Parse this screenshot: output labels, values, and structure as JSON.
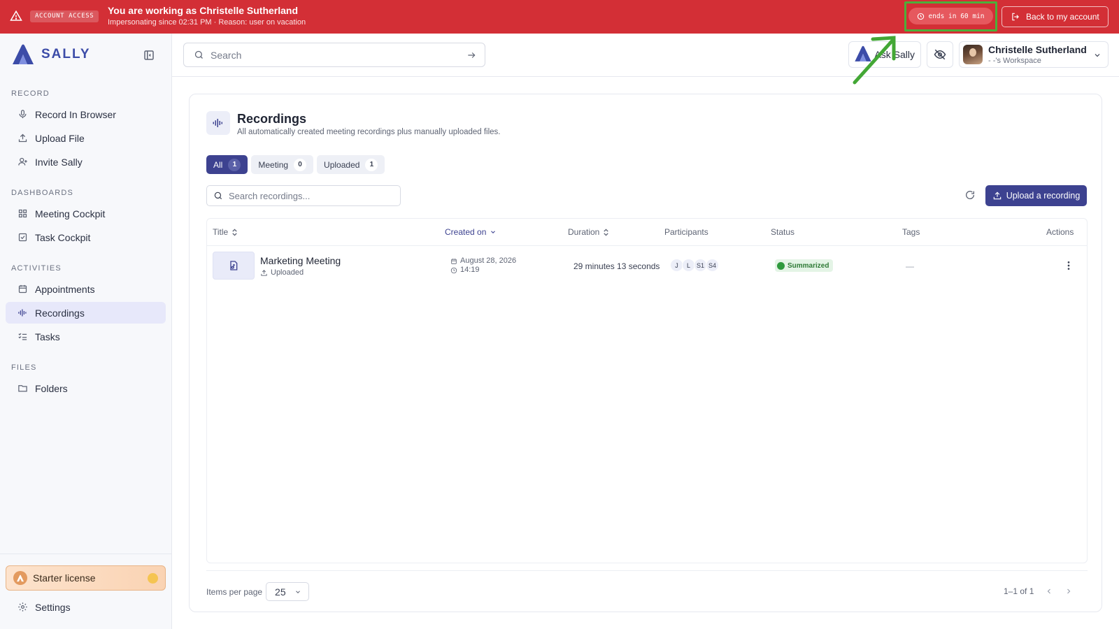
{
  "banner": {
    "tag": "ACCOUNT ACCESS",
    "title": "You are working as Christelle Sutherland",
    "subtitle": "Impersonating since 02:31 PM · Reason: user on vacation",
    "timer": "ends in 60 min",
    "back_label": "Back to my account"
  },
  "sidebar": {
    "brand": "SALLY",
    "sections": {
      "record": "RECORD",
      "dashboards": "DASHBOARDS",
      "activities": "ACTIVITIES",
      "files": "FILES"
    },
    "items": {
      "record_browser": "Record In Browser",
      "upload_file": "Upload File",
      "invite_sally": "Invite Sally",
      "meeting_cockpit": "Meeting Cockpit",
      "task_cockpit": "Task Cockpit",
      "appointments": "Appointments",
      "recordings": "Recordings",
      "tasks": "Tasks",
      "folders": "Folders"
    },
    "license": "Starter license",
    "settings": "Settings"
  },
  "header": {
    "search_placeholder": "Search",
    "ask_label": "Ask Sally",
    "user_name": "Christelle Sutherland",
    "workspace": "- -'s Workspace"
  },
  "page": {
    "title": "Recordings",
    "subtitle": "All automatically created meeting recordings plus manually uploaded files.",
    "filters": [
      {
        "label": "All",
        "count": "1"
      },
      {
        "label": "Meeting",
        "count": "0"
      },
      {
        "label": "Uploaded",
        "count": "1"
      }
    ],
    "search_placeholder": "Search recordings...",
    "upload_label": "Upload a recording"
  },
  "table": {
    "columns": {
      "title": "Title",
      "created": "Created on",
      "duration": "Duration",
      "participants": "Participants",
      "status": "Status",
      "tags": "Tags",
      "actions": "Actions"
    },
    "rows": [
      {
        "title": "Marketing Meeting",
        "source": "Uploaded",
        "date": "August 28, 2026",
        "time": "14:19",
        "duration": "29 minutes 13 seconds",
        "participants": [
          "J",
          "L",
          "S1",
          "S4"
        ],
        "status": "Summarized",
        "tags": "—"
      }
    ]
  },
  "footer": {
    "items_per_page_label": "Items per page",
    "items_per_page": "25",
    "range": "1–1 of 1"
  },
  "colors": {
    "banner": "#d32f36",
    "accent": "#3d4290",
    "brand": "#3c4ca8",
    "highlight": "#4caf3a"
  }
}
